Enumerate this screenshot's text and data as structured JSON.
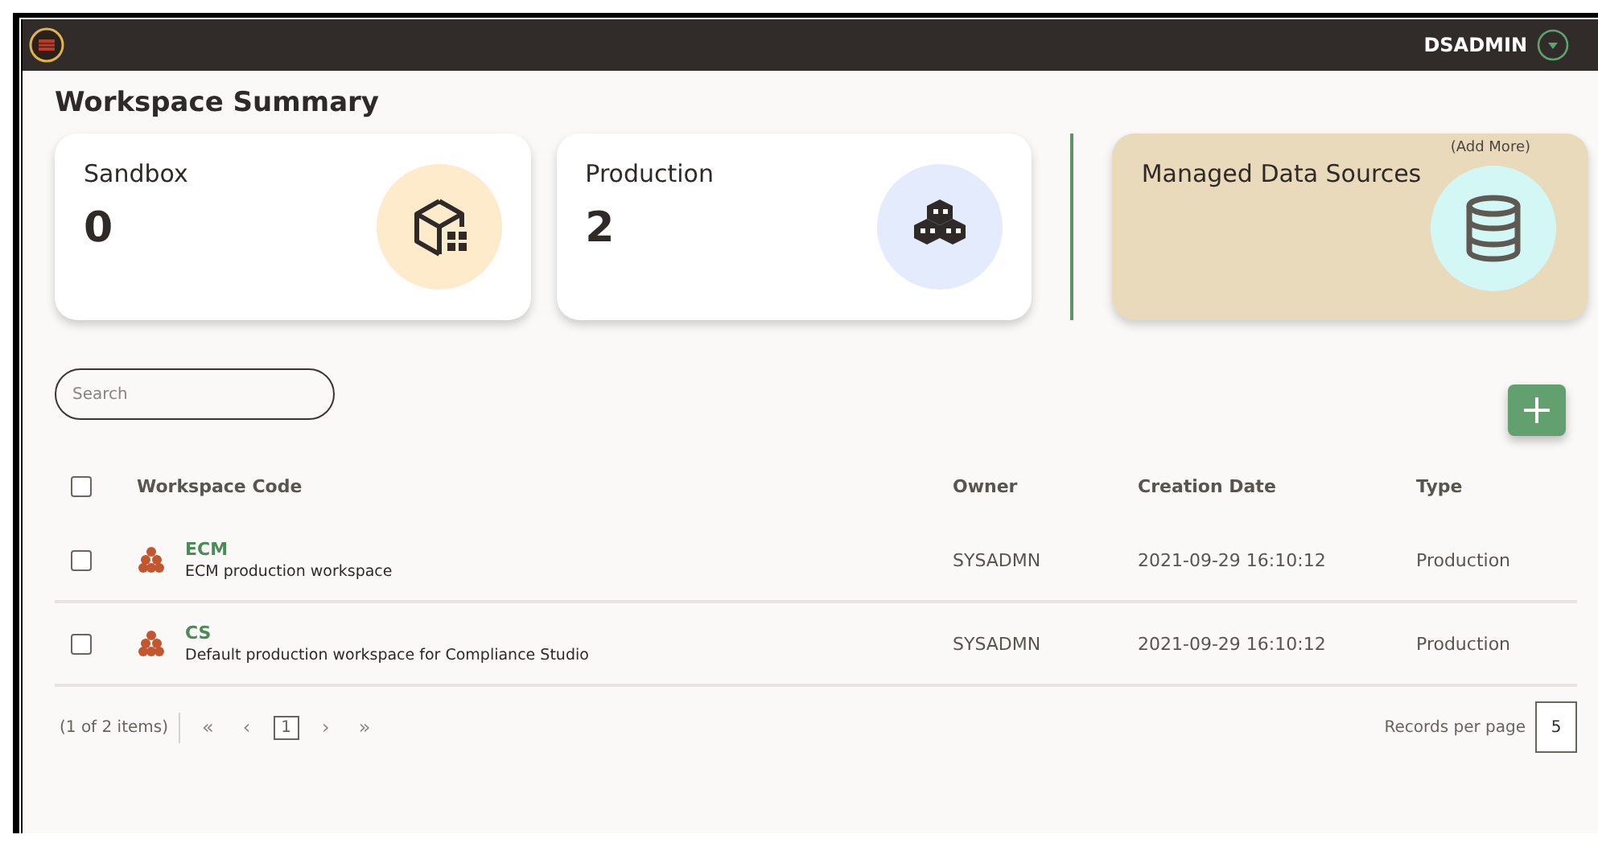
{
  "header": {
    "user": "DSADMIN"
  },
  "title": "Workspace Summary",
  "cards": [
    {
      "kind": "sandbox",
      "label": "Sandbox",
      "count": "0"
    },
    {
      "kind": "production",
      "label": "Production",
      "count": "2"
    },
    {
      "kind": "datasources",
      "label": "Managed Data Sources",
      "link": "(Add More)"
    }
  ],
  "search": {
    "placeholder": "Search"
  },
  "table": {
    "all_checked": false,
    "columns": [
      "Workspace Code",
      "Owner",
      "Creation Date",
      "Type"
    ],
    "rows": [
      {
        "checked": false,
        "code": "ECM",
        "description": "ECM production workspace",
        "owner": "SYSADMN",
        "created": "2021-09-29 16:10:12",
        "type": "Production"
      },
      {
        "checked": false,
        "code": "CS",
        "description": "Default production workspace for Compliance Studio",
        "owner": "SYSADMN",
        "created": "2021-09-29 16:10:12",
        "type": "Production"
      }
    ]
  },
  "pagination": {
    "summary": "(1 of 2 items)",
    "first": "«",
    "prev": "‹",
    "pages": [
      {
        "label": "1",
        "selected": true
      }
    ],
    "next": "›",
    "last": "»",
    "records_label": "Records per page",
    "records_value": "5"
  }
}
